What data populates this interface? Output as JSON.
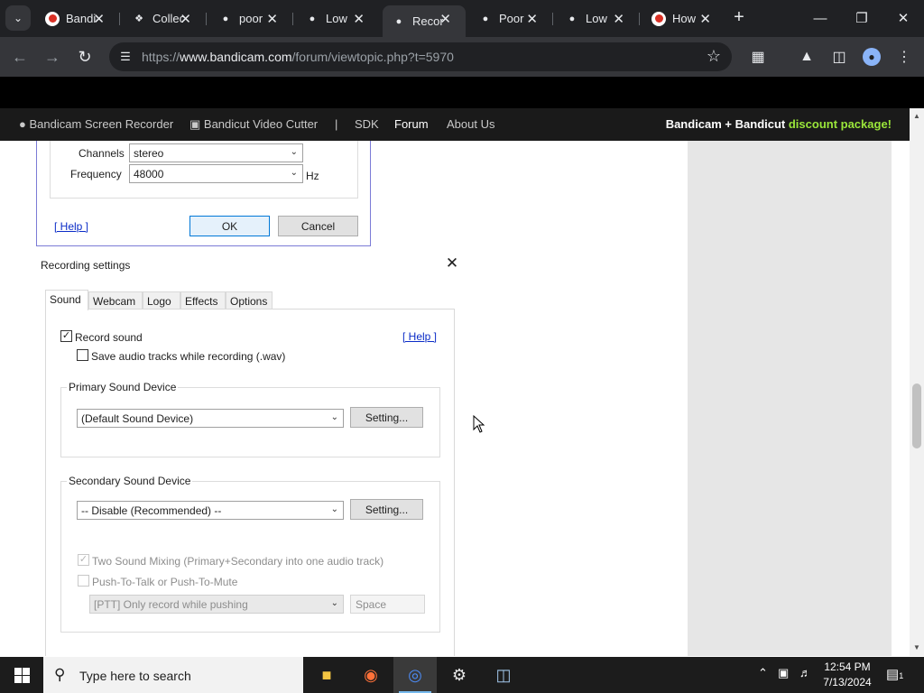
{
  "browser": {
    "tabs": [
      {
        "title": "Bandicam",
        "icon": "record-icon",
        "active": false
      },
      {
        "title": "Collection",
        "icon": "tag-icon",
        "active": false
      },
      {
        "title": "poor",
        "icon": "chat-bubble-icon",
        "active": false
      },
      {
        "title": "Low",
        "icon": "chat-bubble-icon",
        "active": false
      },
      {
        "title": "Recording",
        "icon": "chat-bubble-icon",
        "active": true
      },
      {
        "title": "Poor",
        "icon": "chat-bubble-icon",
        "active": false
      },
      {
        "title": "Low",
        "icon": "chat-bubble-icon",
        "active": false
      },
      {
        "title": "How",
        "icon": "record-icon",
        "active": false
      }
    ],
    "url_prefix": "https://",
    "url_host": "www.bandicam.com",
    "url_path": "/forum/viewtopic.php?t=5970"
  },
  "site_nav": {
    "items": [
      "Bandicam Screen Recorder",
      "Bandicut Video Cutter",
      "|",
      "SDK",
      "Forum",
      "About Us"
    ],
    "active": "Forum",
    "promo_prefix": "Bandicam + Bandicut ",
    "promo_highlight": "discount package!"
  },
  "upper_dialog": {
    "channels_label": "Channels",
    "channels_value": "stereo",
    "frequency_label": "Frequency",
    "frequency_value": "48000",
    "frequency_unit": "Hz",
    "help_link": "[ Help ]",
    "ok_label": "OK",
    "cancel_label": "Cancel"
  },
  "recording_dialog": {
    "title": "Recording settings",
    "tabs": [
      "Sound",
      "Webcam",
      "Logo",
      "Effects",
      "Options"
    ],
    "selected_tab": "Sound",
    "record_sound_label": "Record sound",
    "record_sound_checked": true,
    "help_link": "[ Help ]",
    "save_wav_label": "Save audio tracks while recording (.wav)",
    "save_wav_checked": false,
    "primary_group": "Primary Sound Device",
    "primary_device": "(Default Sound Device)",
    "setting_label": "Setting...",
    "secondary_group": "Secondary Sound Device",
    "secondary_device": "-- Disable (Recommended) --",
    "two_mixing_label": "Two Sound Mixing (Primary+Secondary into one audio track)",
    "two_mixing_checked": true,
    "ptt_label": "Push-To-Talk or Push-To-Mute",
    "ptt_checked": false,
    "ptt_mode": "[PTT] Only record while pushing",
    "ptt_key": "Space"
  },
  "taskbar": {
    "search_placeholder": "Type here to search",
    "time": "12:54 PM",
    "date": "7/13/2024",
    "notification_count": "1"
  }
}
